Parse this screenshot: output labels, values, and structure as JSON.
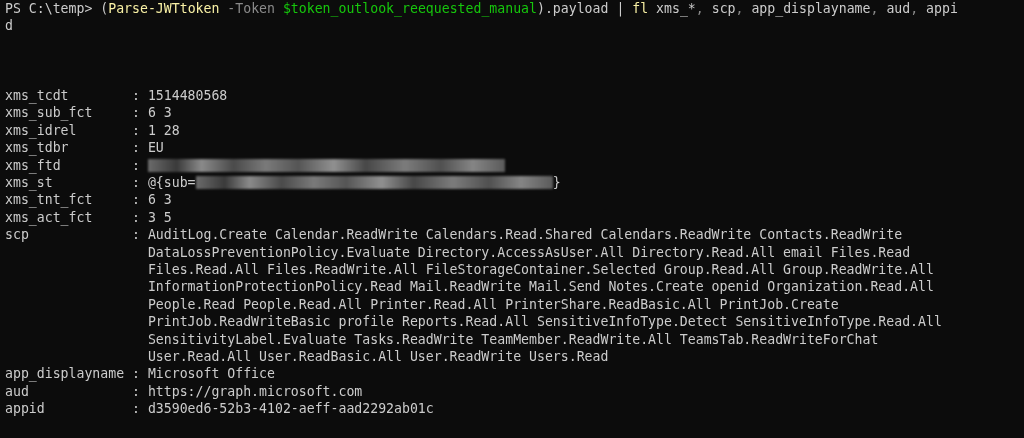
{
  "command_lines": [
    [
      {
        "kind": "prompt",
        "text": "PS C:\\temp> "
      },
      {
        "kind": "plain",
        "text": "("
      },
      {
        "kind": "command",
        "text": "Parse-JWTtoken"
      },
      {
        "kind": "parameter",
        "text": " -Token"
      },
      {
        "kind": "variable",
        "text": " $token_outlook_reequested_manual"
      },
      {
        "kind": "plain",
        "text": ").payload | "
      },
      {
        "kind": "command",
        "text": "fl"
      },
      {
        "kind": "plain",
        "text": " xms_*"
      },
      {
        "kind": "operator",
        "text": ", "
      },
      {
        "kind": "plain",
        "text": "scp"
      },
      {
        "kind": "operator",
        "text": ", "
      },
      {
        "kind": "plain",
        "text": "app_displayname"
      },
      {
        "kind": "operator",
        "text": ", "
      },
      {
        "kind": "plain",
        "text": "aud"
      },
      {
        "kind": "operator",
        "text": ", "
      },
      {
        "kind": "plain",
        "text": "appi"
      }
    ],
    [
      {
        "kind": "plain",
        "text": "d"
      }
    ]
  ],
  "fields": [
    {
      "key": "xms_tcdt",
      "separator": ":",
      "value": [
        {
          "kind": "text",
          "text": "1514480568"
        }
      ]
    },
    {
      "key": "xms_sub_fct",
      "separator": ":",
      "value": [
        {
          "kind": "text",
          "text": "6 3"
        }
      ]
    },
    {
      "key": "xms_idrel",
      "separator": ":",
      "value": [
        {
          "kind": "text",
          "text": "1 28"
        }
      ]
    },
    {
      "key": "xms_tdbr",
      "separator": ":",
      "value": [
        {
          "kind": "text",
          "text": "EU"
        }
      ]
    },
    {
      "key": "xms_ftd",
      "separator": ":",
      "value": [
        {
          "kind": "redacted"
        }
      ]
    },
    {
      "key": "xms_st",
      "separator": ":",
      "value": [
        {
          "kind": "text",
          "text": "@{sub="
        },
        {
          "kind": "redacted"
        },
        {
          "kind": "text",
          "text": "}"
        }
      ]
    },
    {
      "key": "xms_tnt_fct",
      "separator": ":",
      "value": [
        {
          "kind": "text",
          "text": "6 3"
        }
      ]
    },
    {
      "key": "xms_act_fct",
      "separator": ":",
      "value": [
        {
          "kind": "text",
          "text": "3 5"
        }
      ]
    },
    {
      "key": "scp",
      "separator": ":",
      "lines": [
        "AuditLog.Create Calendar.ReadWrite Calendars.Read.Shared Calendars.ReadWrite Contacts.ReadWrite",
        "DataLossPreventionPolicy.Evaluate Directory.AccessAsUser.All Directory.Read.All email Files.Read",
        "Files.Read.All Files.ReadWrite.All FileStorageContainer.Selected Group.Read.All Group.ReadWrite.All",
        "InformationProtectionPolicy.Read Mail.ReadWrite Mail.Send Notes.Create openid Organization.Read.All",
        "People.Read People.Read.All Printer.Read.All PrinterShare.ReadBasic.All PrintJob.Create",
        "PrintJob.ReadWriteBasic profile Reports.Read.All SensitiveInfoType.Detect SensitiveInfoType.Read.All",
        "SensitivityLabel.Evaluate Tasks.ReadWrite TeamMember.ReadWrite.All TeamsTab.ReadWriteForChat",
        "User.Read.All User.ReadBasic.All User.ReadWrite Users.Read"
      ]
    },
    {
      "key": "app_displayname",
      "separator": ":",
      "value": [
        {
          "kind": "text",
          "text": "Microsoft Office"
        }
      ]
    },
    {
      "key": "aud",
      "separator": ":",
      "value": [
        {
          "kind": "text",
          "text": "https://graph.microsoft.com"
        }
      ]
    },
    {
      "key": "appid",
      "separator": ":",
      "value": [
        {
          "kind": "text",
          "text": "d3590ed6-52b3-4102-aeff-aad2292ab01c"
        }
      ]
    }
  ]
}
